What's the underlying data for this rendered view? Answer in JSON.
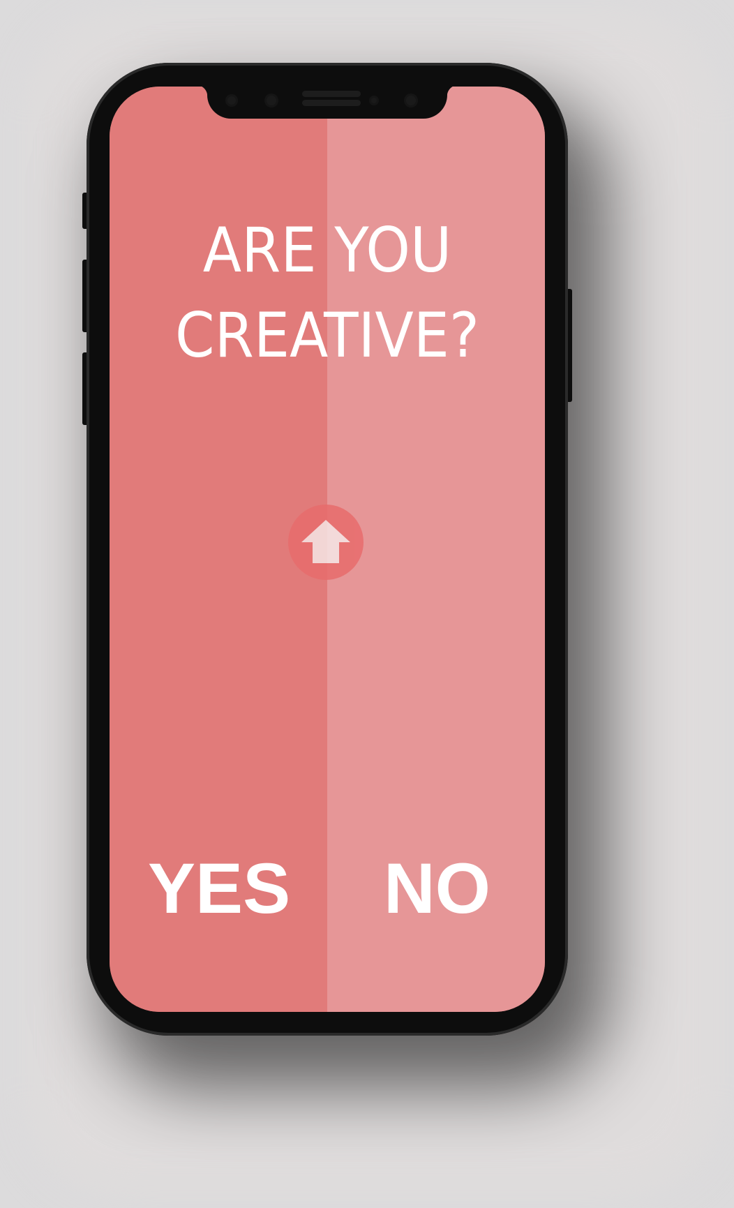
{
  "question": {
    "line1": "ARE YOU",
    "line2": "CREATIVE?"
  },
  "answers": {
    "yes": "YES",
    "no": "NO"
  },
  "swipe_icon": "arrow-up-icon",
  "colors": {
    "background": "#dcdbdc",
    "yes_side": "#e17b7a",
    "no_side": "#e69697",
    "swipe_circle": "#e86c6c",
    "text": "#ffffff",
    "phone_frame": "#0d0d0d"
  }
}
